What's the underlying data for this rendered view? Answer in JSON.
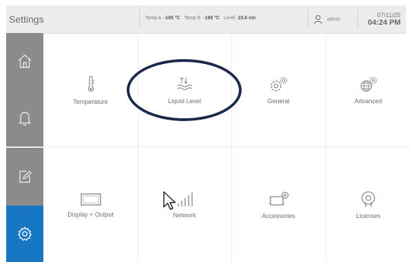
{
  "header": {
    "title": "Settings",
    "temp_a_label": "Temp A",
    "temp_a_value": "-165 °C",
    "temp_b_label": "Temp B",
    "temp_b_value": "-188 °C",
    "level_label": "Level",
    "level_value": "23.6 cm",
    "user_icon": "user-icon",
    "username": "admin",
    "date": "07/11/25",
    "time": "04:24 PM"
  },
  "sidebar": {
    "items": [
      {
        "icon": "home-icon",
        "color": "#8b8b8b"
      },
      {
        "icon": "bell-icon",
        "color": "#8b8b8b"
      },
      {
        "icon": "edit-icon",
        "color": "#8b8b8b"
      },
      {
        "icon": "gear-icon",
        "color": "#1777c2",
        "active": true
      }
    ]
  },
  "tiles": [
    {
      "label": "Temperature",
      "icon": "thermometer-icon"
    },
    {
      "label": "Liquid Level",
      "icon": "liquid-level-icon"
    },
    {
      "label": "General",
      "icon": "gears-icon"
    },
    {
      "label": "Advanced",
      "icon": "globe-gear-icon"
    },
    {
      "label": "Display + Output",
      "icon": "display-icon"
    },
    {
      "label": "Network",
      "icon": "signal-bars-icon"
    },
    {
      "label": "Accessories",
      "icon": "accessories-icon"
    },
    {
      "label": "Licenses",
      "icon": "license-icon"
    }
  ],
  "colors": {
    "header_bg": "#ececec",
    "sidebar_bg": "#8b8b8b",
    "active_blue": "#1777c2",
    "annotation_oval": "#1b2a4a"
  }
}
